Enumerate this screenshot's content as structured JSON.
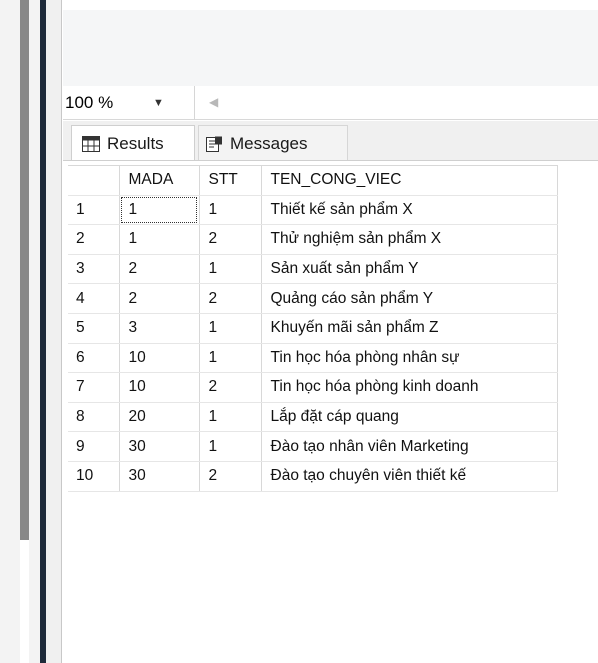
{
  "zoom": {
    "value": "100 %"
  },
  "tabs": {
    "results_label": "Results",
    "messages_label": "Messages"
  },
  "columns": [
    "",
    "MADA",
    "STT",
    "TEN_CONG_VIEC"
  ],
  "rows": [
    [
      "1",
      "1",
      "1",
      "Thiết kế sản phẩm X"
    ],
    [
      "2",
      "1",
      "2",
      "Thử nghiệm sản phẩm X"
    ],
    [
      "3",
      "2",
      "1",
      "Sản xuất sản phẩm Y"
    ],
    [
      "4",
      "2",
      "2",
      "Quảng cáo sản phẩm Y"
    ],
    [
      "5",
      "3",
      "1",
      "Khuyến mãi sản phẩm Z"
    ],
    [
      "6",
      "10",
      "1",
      "Tin học hóa phòng nhân sự"
    ],
    [
      "7",
      "10",
      "2",
      "Tin học hóa phòng kinh doanh"
    ],
    [
      "8",
      "20",
      "1",
      "Lắp đặt cáp quang"
    ],
    [
      "9",
      "30",
      "1",
      "Đào tạo nhân viên Marketing"
    ],
    [
      "10",
      "30",
      "2",
      "Đào tạo chuyên viên thiết kế"
    ]
  ]
}
